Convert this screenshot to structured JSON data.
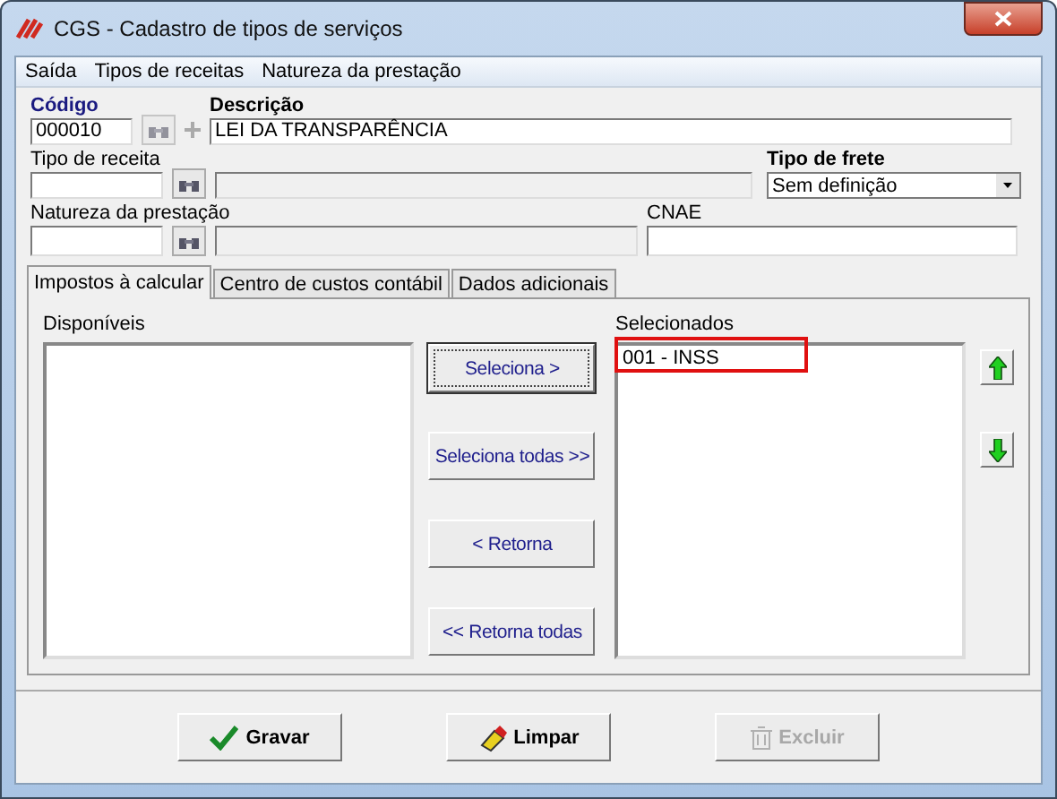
{
  "window": {
    "title": "CGS - Cadastro de tipos de serviços"
  },
  "menu": [
    "Saída",
    "Tipos de receitas",
    "Natureza da prestação"
  ],
  "codigo": {
    "label": "Código",
    "value": "000010"
  },
  "descricao": {
    "label": "Descrição",
    "value": "LEI DA TRANSPARÊNCIA"
  },
  "tipo_receita": {
    "label": "Tipo de receita"
  },
  "tipo_frete": {
    "label": "Tipo de frete",
    "value": "Sem definição"
  },
  "natureza": {
    "label": "Natureza da prestação"
  },
  "cnae": {
    "label": "CNAE"
  },
  "tabs": [
    {
      "label": "Impostos à calcular",
      "selected": true
    },
    {
      "label": "Centro de custos contábil",
      "selected": false
    },
    {
      "label": "Dados adicionais",
      "selected": false
    }
  ],
  "available": {
    "label": "Disponíveis"
  },
  "transfer_buttons": [
    {
      "label": "Seleciona >",
      "focused": true
    },
    {
      "label": "Seleciona todas >>",
      "focused": false
    },
    {
      "label": "< Retorna",
      "focused": false
    },
    {
      "label": "<< Retorna todas",
      "focused": false
    }
  ],
  "selected_list": {
    "label": "Selecionados",
    "items": [
      {
        "label": "001 - INSS",
        "highlighted": true
      }
    ]
  },
  "actions": [
    {
      "kind": "save",
      "label": "Gravar",
      "disabled": false
    },
    {
      "kind": "clear",
      "label": "Limpar",
      "disabled": false
    },
    {
      "kind": "delete",
      "label": "Excluir",
      "disabled": true
    }
  ]
}
